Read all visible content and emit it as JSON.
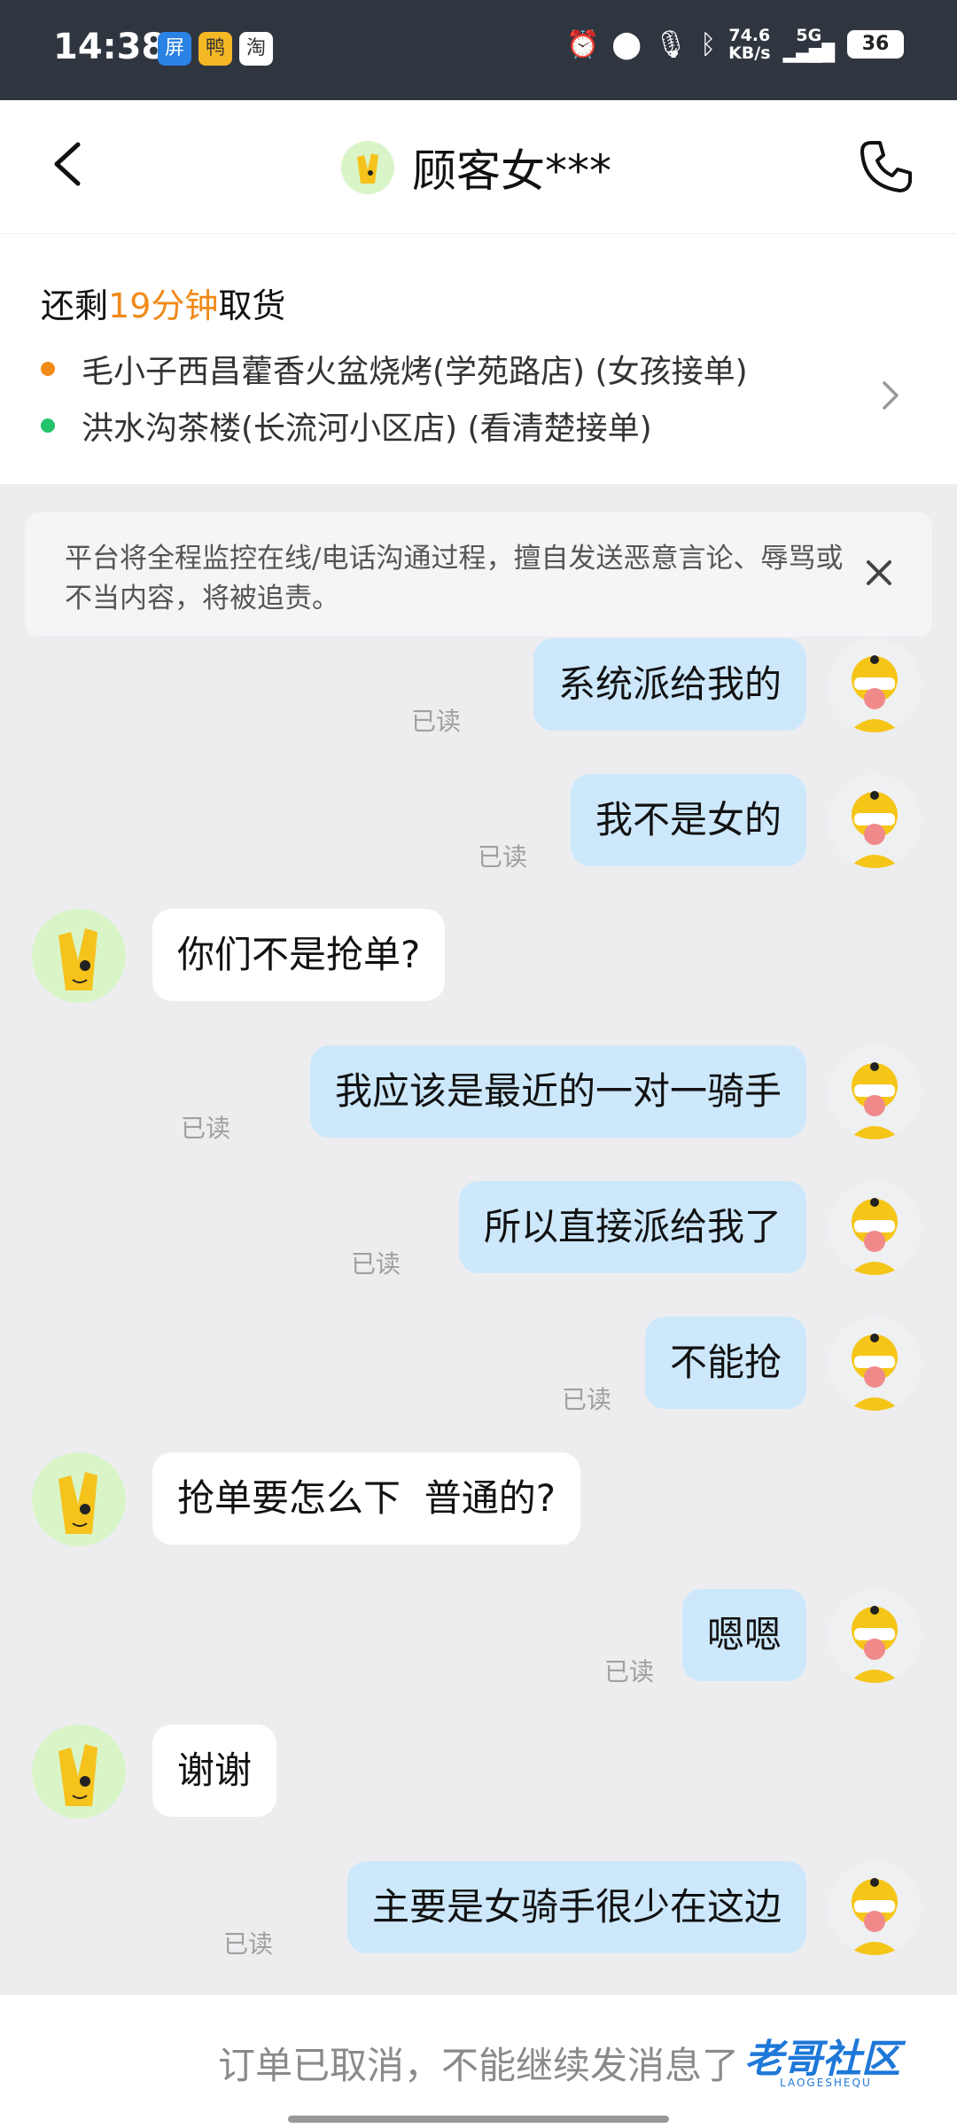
{
  "status_bar": {
    "time": "14:38",
    "app_icons": [
      "屏",
      "鸭",
      "淘"
    ],
    "net_speed": "74.6",
    "net_unit": "KB/s",
    "network": "5G",
    "battery": "36"
  },
  "header": {
    "title": "顾客女***"
  },
  "order": {
    "remain_prefix": "还剩",
    "remain_time": "19分钟",
    "remain_suffix": "取货",
    "stores": [
      {
        "name": "毛小子西昌藿香火盆烧烤(学苑路店) (女孩接单)",
        "dot_color": "#f08a18"
      },
      {
        "name": "洪水沟茶楼(长流河小区店) (看清楚接单)",
        "dot_color": "#22c36b"
      }
    ]
  },
  "notice": {
    "text": "平台将全程监控在线/电话沟通过程，擅自发送恶意言论、辱骂或不当内容，将被追责。"
  },
  "messages": [
    {
      "sender": "me",
      "text": "系统派给我的",
      "status": "已读"
    },
    {
      "sender": "me",
      "text": "我不是女的",
      "status": "已读"
    },
    {
      "sender": "them",
      "text": "你们不是抢单?"
    },
    {
      "sender": "me",
      "text": "我应该是最近的一对一骑手",
      "status": "已读"
    },
    {
      "sender": "me",
      "text": "所以直接派给我了",
      "status": "已读"
    },
    {
      "sender": "me",
      "text": "不能抢",
      "status": "已读"
    },
    {
      "sender": "them",
      "text": "抢单要怎么下  普通的?"
    },
    {
      "sender": "me",
      "text": "嗯嗯",
      "status": "已读"
    },
    {
      "sender": "them",
      "text": "谢谢"
    },
    {
      "sender": "me",
      "text": "主要是女骑手很少在这边",
      "status": "已读"
    }
  ],
  "footer": {
    "text": "订单已取消，不能继续发消息了",
    "watermark": "老哥社区",
    "watermark_sub": "LAOGESHEQU"
  },
  "colors": {
    "accent": "#f08a18",
    "my_bubble": "#cde8fb",
    "their_bubble": "#ffffff",
    "background": "#ededf0"
  }
}
